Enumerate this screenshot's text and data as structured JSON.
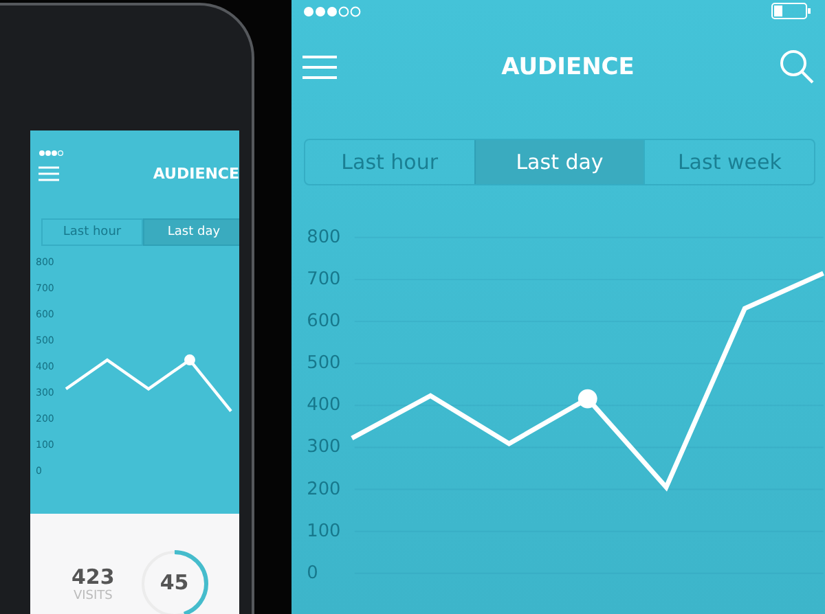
{
  "phone_preview": {
    "title": "AUDIENCE",
    "tabs": [
      {
        "label": "Last hour",
        "selected": false
      },
      {
        "label": "Last day",
        "selected": true
      }
    ],
    "chart_data": {
      "type": "line",
      "ylim": [
        0,
        800
      ],
      "yticks": [
        0,
        100,
        200,
        300,
        400,
        500,
        600,
        700,
        800
      ],
      "grid": false,
      "series": [
        {
          "color": "#ffffff",
          "values": [
            315,
            426,
            315,
            426,
            230
          ]
        }
      ]
    },
    "stats": {
      "visits_value": "423",
      "visits_label": "VISITS",
      "ring_value": "45"
    }
  },
  "screen": {
    "title": "AUDIENCE",
    "tabs": [
      {
        "label": "Last hour",
        "selected": false
      },
      {
        "label": "Last day",
        "selected": true
      },
      {
        "label": "Last week",
        "selected": false
      }
    ],
    "chart_data": {
      "type": "line",
      "ylim": [
        0,
        800
      ],
      "yticks": [
        0,
        100,
        200,
        300,
        400,
        500,
        600,
        700,
        800
      ],
      "grid": true,
      "series": [
        {
          "color": "#ffffff",
          "values": [
            322,
            423,
            309,
            416,
            205,
            631,
            715
          ]
        }
      ]
    }
  }
}
